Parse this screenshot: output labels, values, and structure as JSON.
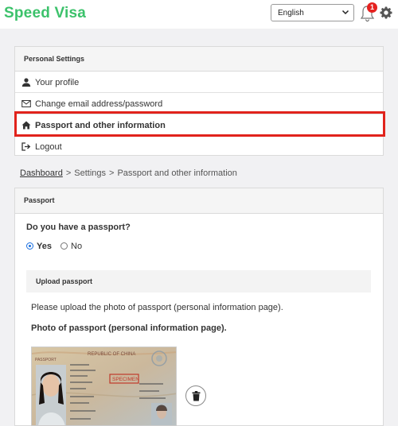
{
  "header": {
    "logo": "Speed Visa",
    "language": "English",
    "notification_count": "1",
    "icons": {
      "bell": "bell-icon",
      "settings": "gear-icon"
    },
    "colors": {
      "brand": "#3cc26b",
      "badge": "#e5211f"
    }
  },
  "settings_card": {
    "title": "Personal Settings",
    "items": [
      {
        "label": "Your profile",
        "icon": "user-icon"
      },
      {
        "label": "Change email address/password",
        "icon": "envelope-icon"
      },
      {
        "label": "Passport and other information",
        "icon": "home-icon",
        "active": true
      },
      {
        "label": "Logout",
        "icon": "logout-icon"
      }
    ],
    "highlight_color": "#e1231c"
  },
  "breadcrumb": {
    "home": "Dashboard",
    "sep": ">",
    "settings": "Settings",
    "current": "Passport and other information"
  },
  "passport": {
    "title": "Passport",
    "question": "Do you have a passport?",
    "options": [
      {
        "label": "Yes",
        "selected": true
      },
      {
        "label": "No",
        "selected": false
      }
    ],
    "upload_title": "Upload passport",
    "upload_desc": "Please upload the photo of passport (personal information page).",
    "photo_title": "Photo of passport (personal information page).",
    "photo_texts": {
      "country": "REPUBLIC OF CHINA",
      "doc": "PASSPORT",
      "stamp": "SPECIMEN"
    },
    "delete_icon": "trash-icon"
  }
}
